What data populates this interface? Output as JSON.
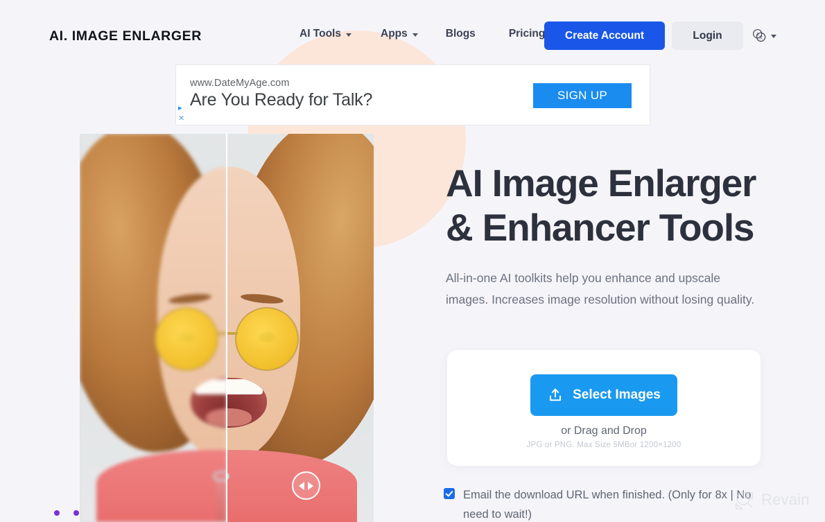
{
  "header": {
    "logo": "AI. IMAGE ENLARGER",
    "nav": [
      {
        "label": "AI Tools",
        "has_dropdown": true
      },
      {
        "label": "Apps",
        "has_dropdown": true
      },
      {
        "label": "Blogs",
        "has_dropdown": false
      },
      {
        "label": "Pricing",
        "has_dropdown": false
      }
    ],
    "create_account_label": "Create Account",
    "login_label": "Login",
    "language_icon": "translate-icon",
    "accent_blue": "#1a56e8",
    "login_bg": "#e9ebf0"
  },
  "ad": {
    "url": "www.DateMyAge.com",
    "headline": "Are You Ready for Talk?",
    "cta_label": "SIGN UP",
    "adchoices_icon": "adchoices-triangle-icon",
    "close_icon": "close-x-icon",
    "cta_color": "#1a8cf0"
  },
  "hero": {
    "title_line1": "AI Image Enlarger",
    "title_line2": "& Enhancer Tools",
    "subtitle": "All-in-one AI toolkits help you enhance and upscale images. Increases image resolution without losing quality.",
    "comparison": {
      "left_state": "before-blurry",
      "right_state": "after-sharp",
      "handle_icon": "left-right-arrows-icon",
      "slider_position_percent": 50
    }
  },
  "upload": {
    "select_images_label": "Select Images",
    "upload_icon": "upload-icon",
    "drag_drop_label": "or Drag and Drop",
    "hint": "JPG or PNG. Max Size 5MBor 1200×1200",
    "button_color": "#1a99f0"
  },
  "email_option": {
    "checked": true,
    "label": "Email the download URL when finished. (Only for 8x | No need to wait!)"
  },
  "watermark": {
    "text": "Revain",
    "icon": "revain-logo-icon"
  },
  "decor": {
    "peach_circle": "#fce3d4",
    "dot_color": "#7b2fd6",
    "page_bg": "#f5f5f9"
  }
}
